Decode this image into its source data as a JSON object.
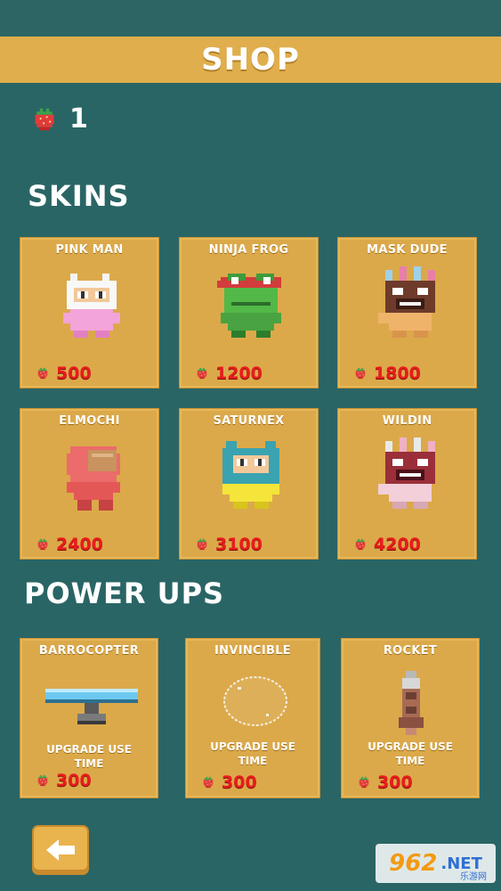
{
  "header": {
    "title": "SHOP"
  },
  "currency": {
    "icon": "strawberry-icon",
    "count": "1"
  },
  "sections": {
    "skins_title": "SKINS",
    "powerups_title": "POWER UPS"
  },
  "skins": [
    {
      "name": "PINK MAN",
      "price": "500"
    },
    {
      "name": "NINJA FROG",
      "price": "1200"
    },
    {
      "name": "MASK DUDE",
      "price": "1800"
    },
    {
      "name": "ELMOCHI",
      "price": "2400"
    },
    {
      "name": "SATURNEX",
      "price": "3100"
    },
    {
      "name": "WILDIN",
      "price": "4200"
    }
  ],
  "powerups": [
    {
      "name": "BARROCOPTER",
      "desc_line1": "UPGRADE USE",
      "desc_line2": "TIME",
      "price": "300"
    },
    {
      "name": "INVINCIBLE",
      "desc_line1": "UPGRADE USE",
      "desc_line2": "TIME",
      "price": "300"
    },
    {
      "name": "ROCKET",
      "desc_line1": "UPGRADE USE",
      "desc_line2": "TIME",
      "price": "300"
    }
  ],
  "back": {
    "icon": "arrow-left-icon"
  },
  "watermark": {
    "logo": "962",
    "net": ".NET",
    "sub": "乐游网"
  },
  "colors": {
    "background": "#2a6565",
    "header": "#e0ae4c",
    "card": "#dba94a",
    "price": "#ea1c1c"
  }
}
